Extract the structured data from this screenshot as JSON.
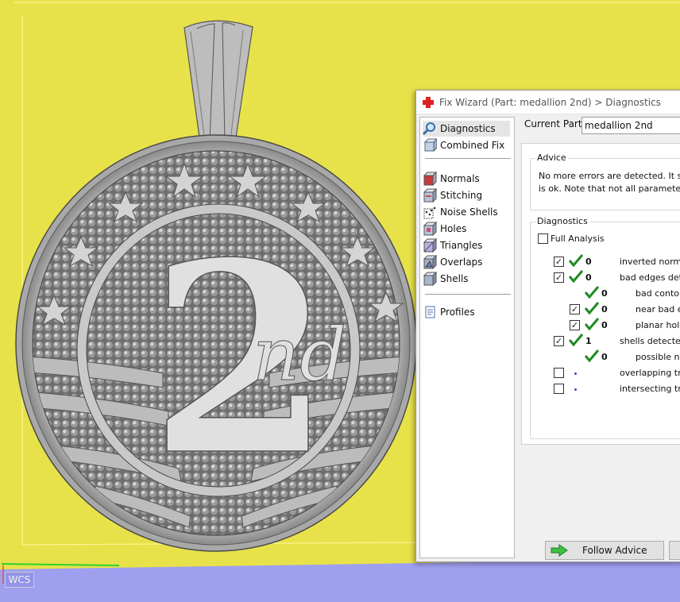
{
  "colors": {
    "viewport_bg": "#e8e24a",
    "floor": "#9f9ff0",
    "medal": "#b3b3b3",
    "axis_green": "#2fd12f",
    "check_green": "#1f8a1f",
    "dot_blue": "#2a4fc9"
  },
  "viewport": {
    "wcs_label": "WCS",
    "medal_number": "2",
    "medal_suffix": "nd"
  },
  "wizard": {
    "title": "Fix Wizard (Part: medallion 2nd) > Diagnostics",
    "nav": [
      {
        "label": "Diagnostics",
        "icon": "magnifier-icon",
        "selected": true
      },
      {
        "label": "Combined Fix",
        "icon": "combined-fix-icon"
      },
      {
        "label": "Normals",
        "icon": "normals-icon"
      },
      {
        "label": "Stitching",
        "icon": "stitching-icon"
      },
      {
        "label": "Noise Shells",
        "icon": "noise-shells-icon"
      },
      {
        "label": "Holes",
        "icon": "holes-icon"
      },
      {
        "label": "Triangles",
        "icon": "triangles-icon"
      },
      {
        "label": "Overlaps",
        "icon": "overlaps-icon"
      },
      {
        "label": "Shells",
        "icon": "shells-icon"
      },
      {
        "label": "Profiles",
        "icon": "profiles-icon"
      }
    ],
    "current_part_label": "Current Part:",
    "current_part_value": "medallion 2nd",
    "advice": {
      "legend": "Advice",
      "line1": "No more errors are detected. It seem",
      "line2": "is ok. Note that not all parameters we"
    },
    "diagnostics": {
      "legend": "Diagnostics",
      "full_analysis_label": "Full Analysis",
      "rows": [
        {
          "checked": true,
          "status": "ok",
          "count": "0",
          "label": "inverted normal"
        },
        {
          "checked": true,
          "status": "ok",
          "count": "0",
          "label": "bad edges dete"
        },
        {
          "checked": null,
          "status": "ok",
          "count": "0",
          "label": "bad contour"
        },
        {
          "checked": true,
          "status": "ok",
          "count": "0",
          "label": "near bad ec"
        },
        {
          "checked": true,
          "status": "ok",
          "count": "0",
          "label": "planar holes"
        },
        {
          "checked": true,
          "status": "ok",
          "count": "1",
          "label": "shells detected"
        },
        {
          "checked": null,
          "status": "ok",
          "count": "0",
          "label": "possible noi"
        },
        {
          "checked": false,
          "status": "pending",
          "count": "",
          "label": "overlapping tria"
        },
        {
          "checked": false,
          "status": "pending",
          "count": "",
          "label": "intersecting tria"
        }
      ]
    },
    "follow_advice_label": "Follow Advice"
  }
}
